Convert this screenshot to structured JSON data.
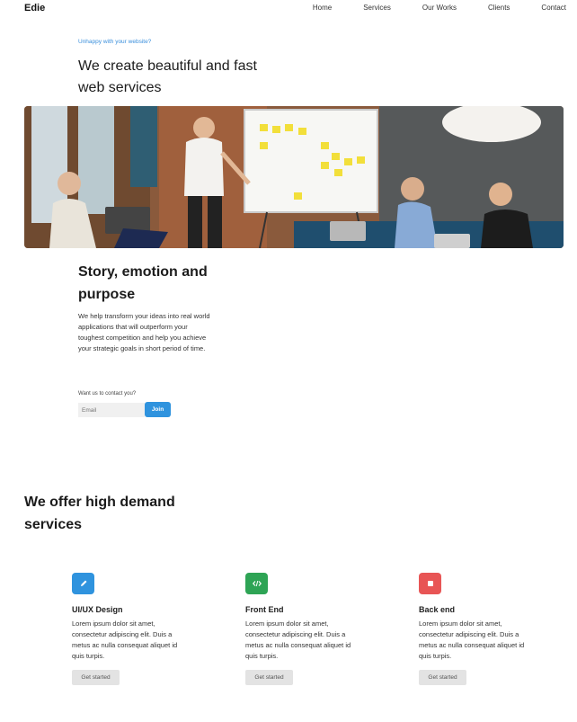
{
  "brand": "Edie",
  "nav": {
    "items": [
      "Home",
      "Services",
      "Our Works",
      "Clients",
      "Contact"
    ]
  },
  "hero": {
    "eyebrow": "Unhappy with your website?",
    "title": "We create beautiful and fast web services"
  },
  "story": {
    "title": "Story, emotion and purpose",
    "text": "We help transform your ideas into real world applications that will outperform your toughest competition and help you achieve your strategic goals in short period of time.",
    "contact_label": "Want us to contact you?",
    "email_placeholder": "Email",
    "join_label": "Join"
  },
  "services": {
    "title": "We offer high demand services",
    "cards": [
      {
        "icon": "pencil-icon",
        "icon_color": "#2f93de",
        "title": "UI/UX Design",
        "text": "Lorem ipsum dolor sit amet, consectetur adipiscing elit. Duis a metus ac nulla consequat aliquet id quis turpis.",
        "button": "Get started"
      },
      {
        "icon": "code-icon",
        "icon_color": "#2ea455",
        "title": "Front End",
        "text": "Lorem ipsum dolor sit amet, consectetur adipiscing elit. Duis a metus ac nulla consequat aliquet id quis turpis.",
        "button": "Get started"
      },
      {
        "icon": "square-icon",
        "icon_color": "#e85555",
        "title": "Back end",
        "text": "Lorem ipsum dolor sit amet, consectetur adipiscing elit. Duis a metus ac nulla consequat aliquet id quis turpis.",
        "button": "Get started"
      }
    ]
  },
  "colors": {
    "accent": "#2f93de",
    "eyebrow": "#3a8fdc"
  }
}
